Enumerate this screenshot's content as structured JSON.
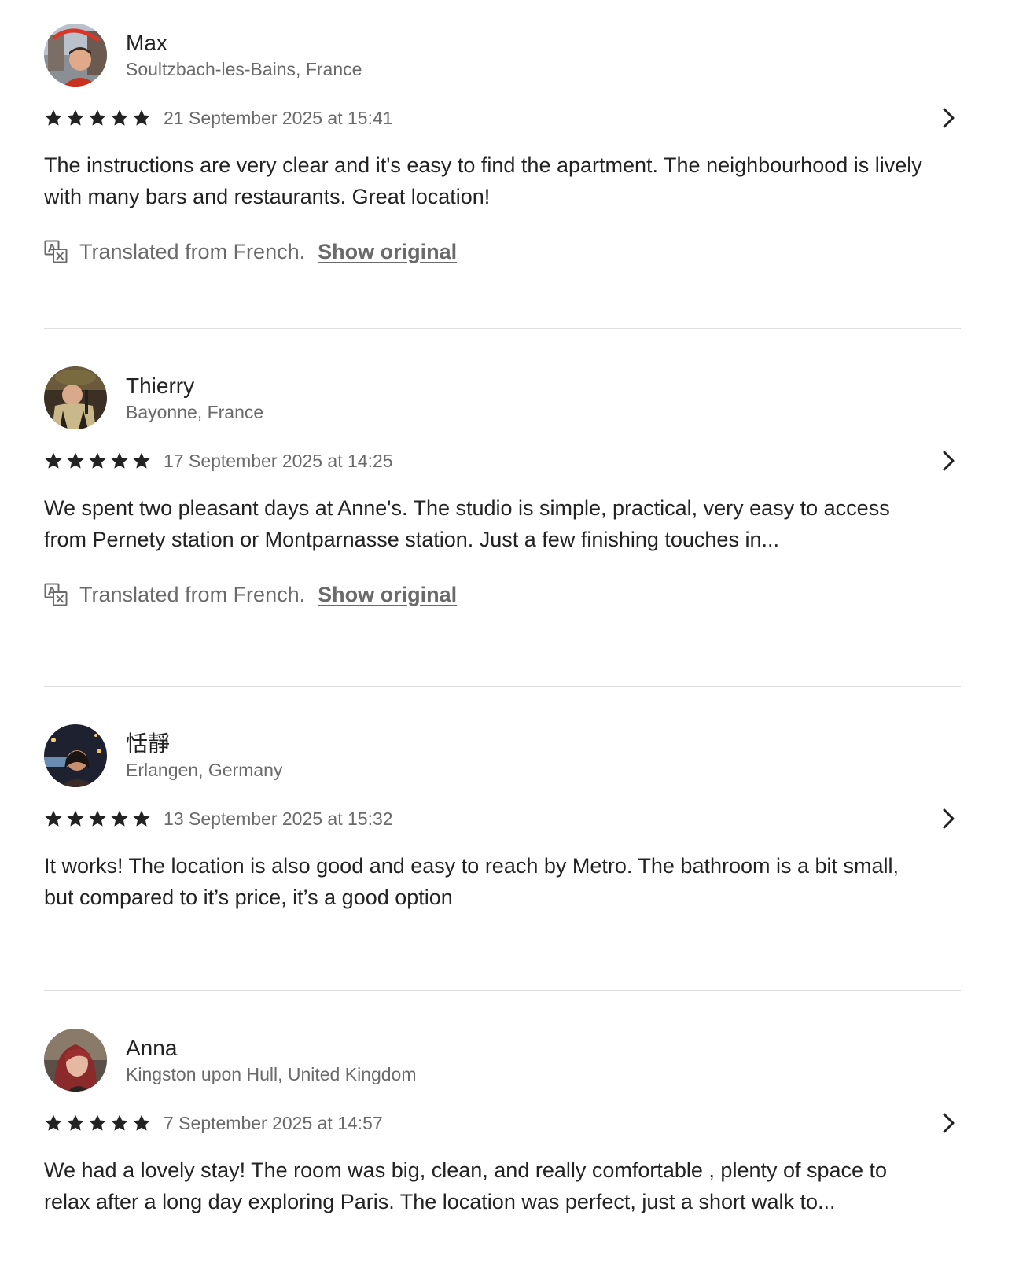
{
  "reviews": [
    {
      "name": "Max",
      "location": "Soultzbach-les-Bains, France",
      "date": "21 September 2025 at 15:41",
      "rating": 5,
      "text": "The instructions are very clear and it's easy to find the apartment. The neighbourhood is lively with many bars and restaurants. Great location!",
      "translated_note": "Translated from French.",
      "show_original": "Show original"
    },
    {
      "name": "Thierry",
      "location": "Bayonne, France",
      "date": "17 September 2025 at 14:25",
      "rating": 5,
      "text": "We spent two pleasant days at Anne's. The studio is simple, practical, very easy to access from Pernety station or Montparnasse station. Just a few finishing touches in...",
      "translated_note": "Translated from French.",
      "show_original": "Show original"
    },
    {
      "name": "恬靜",
      "location": "Erlangen, Germany",
      "date": "13 September 2025 at 15:32",
      "rating": 5,
      "text": "It works! The location is also good and easy to reach by Metro. The bathroom is a bit small, but compared to it’s price, it’s a good option"
    },
    {
      "name": "Anna",
      "location": "Kingston upon Hull, United Kingdom",
      "date": "7 September 2025 at 14:57",
      "rating": 5,
      "text": "We had a lovely stay! The room was big, clean, and really comfortable , plenty of space to relax after a long day exploring Paris. The location was perfect, just a short walk to..."
    }
  ],
  "icons": {
    "star": "star-icon",
    "chevron": "chevron-right-icon",
    "translate": "translate-icon"
  },
  "colors": {
    "text_primary": "#222222",
    "text_secondary": "#6a6a6a",
    "divider": "#dddddd"
  }
}
